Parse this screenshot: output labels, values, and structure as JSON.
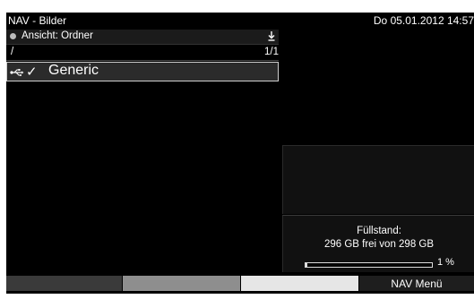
{
  "header": {
    "title": "NAV - Bilder",
    "datetime": "Do 05.01.2012  14:57"
  },
  "view": {
    "label": "Ansicht: Ordner",
    "icon": "download-arrow-icon"
  },
  "path": {
    "current": "/",
    "page": "1/1"
  },
  "items": [
    {
      "name": "Generic",
      "icon": "usb-icon",
      "checked": true
    }
  ],
  "storage": {
    "title": "Füllstand:",
    "detail": "296 GB frei von 298 GB",
    "percent_label": "1 %",
    "used_fraction": 0.01
  },
  "footer": {
    "colors": [
      "#3a3a3a",
      "#8e8e8e",
      "#e6e6e6"
    ],
    "menu_label": "NAV Menü"
  }
}
